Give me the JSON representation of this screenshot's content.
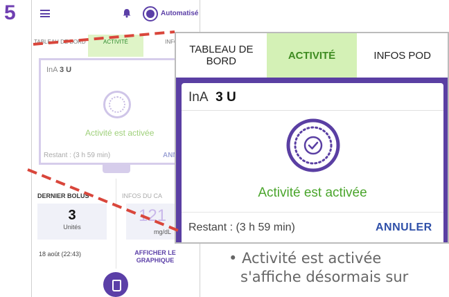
{
  "step_number": "5",
  "phone": {
    "mode_label": "Automatisé",
    "tabs": [
      {
        "label": "TABLEAU DE BORD"
      },
      {
        "label": "ACTIVITÉ"
      },
      {
        "label": "INFO"
      }
    ],
    "insulin_label": "InA",
    "insulin_value": "3 U",
    "status": "Activité est activée",
    "remaining": "Restant : (3 h 59 min)",
    "cancel": "ANN",
    "last_bolus_title": "DERNIER BOLUS",
    "last_bolus_value": "3",
    "last_bolus_unit": "Unités",
    "last_bolus_date": "18 août (22:43)",
    "glucose_title": "INFOS DU CA",
    "glucose_value": "121",
    "glucose_unit": "mg/dL",
    "graph_link": "AFFICHER LE GRAPHIQUE"
  },
  "zoom": {
    "tabs": [
      {
        "label": "TABLEAU DE BORD",
        "active": false
      },
      {
        "label": "ACTIVITÉ",
        "active": true
      },
      {
        "label": "INFOS POD",
        "active": false
      }
    ],
    "insulin_label": "InA",
    "insulin_value": "3 U",
    "status": "Activité est activée",
    "remaining": "Restant : (3 h 59 min)",
    "cancel": "ANNULER"
  },
  "bullet": {
    "line1": "• Activité est activée",
    "line2": "s'affiche désormais sur"
  },
  "colors": {
    "brand_purple": "#5a3fa3",
    "active_tab_bg": "#d4f1b6",
    "active_text_green": "#4aa52c",
    "dash_red": "#d9463b"
  }
}
